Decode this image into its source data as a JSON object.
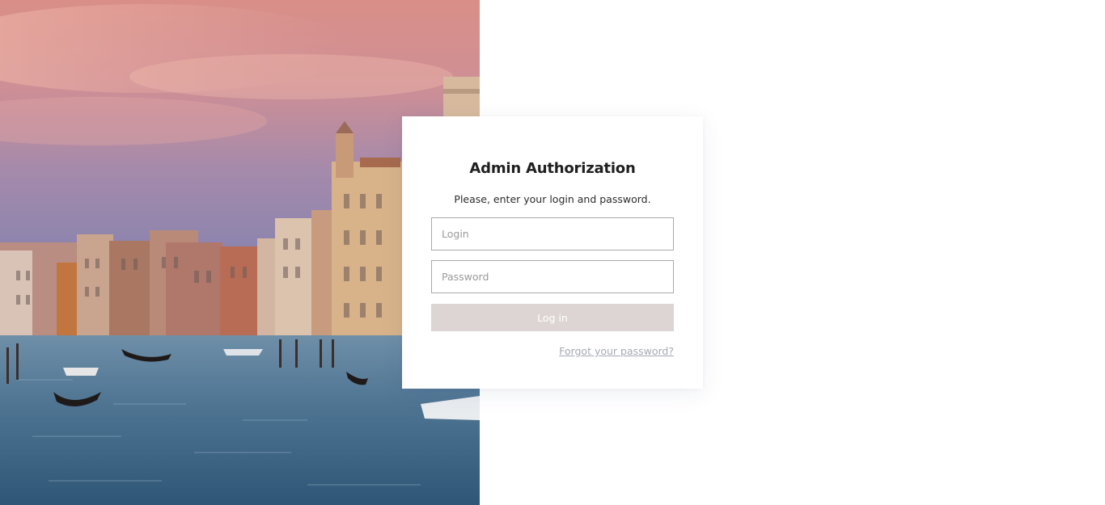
{
  "login_form": {
    "title": "Admin Authorization",
    "subtitle": "Please, enter your login and password.",
    "login_placeholder": "Login",
    "login_value": "",
    "password_placeholder": "Password",
    "password_value": "",
    "submit_label": "Log in",
    "forgot_label": "Forgot your password?"
  },
  "colors": {
    "button_background": "#ddd5d3",
    "link": "#a5a9b3",
    "input_border": "#a9a9a9"
  }
}
